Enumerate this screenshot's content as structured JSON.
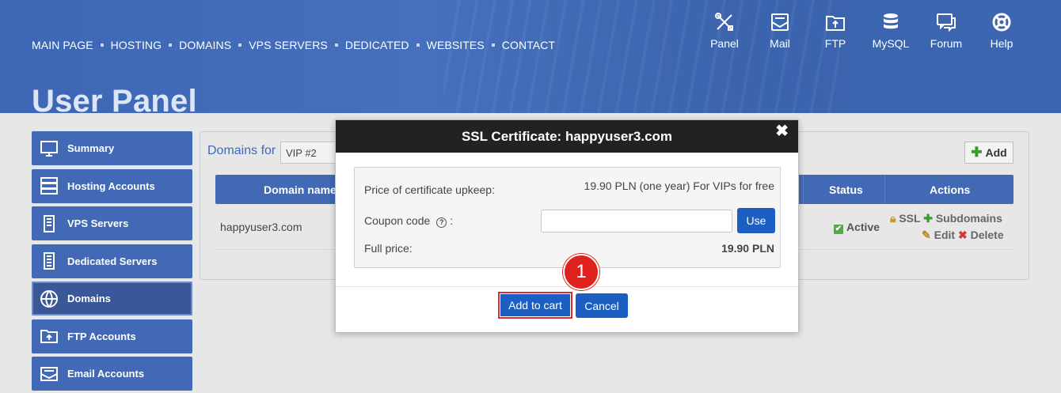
{
  "nav": {
    "items": [
      "MAIN PAGE",
      "HOSTING",
      "DOMAINS",
      "VPS SERVERS",
      "DEDICATED",
      "WEBSITES",
      "CONTACT"
    ]
  },
  "tools": [
    {
      "label": "Panel",
      "icon": "tools-icon"
    },
    {
      "label": "Mail",
      "icon": "mail-icon"
    },
    {
      "label": "FTP",
      "icon": "folder-upload-icon"
    },
    {
      "label": "MySQL",
      "icon": "database-icon"
    },
    {
      "label": "Forum",
      "icon": "chat-icon"
    },
    {
      "label": "Help",
      "icon": "lifebuoy-icon"
    }
  ],
  "page_title": "User Panel",
  "sidebar": {
    "items": [
      {
        "label": "Summary",
        "icon": "monitor-icon"
      },
      {
        "label": "Hosting Accounts",
        "icon": "server-icon"
      },
      {
        "label": "VPS Servers",
        "icon": "vps-icon"
      },
      {
        "label": "Dedicated Servers",
        "icon": "dedicated-icon"
      },
      {
        "label": "Domains",
        "icon": "www-globe-icon"
      },
      {
        "label": "FTP Accounts",
        "icon": "ftp-folder-icon"
      },
      {
        "label": "Email Accounts",
        "icon": "email-icon"
      }
    ],
    "active": "Domains"
  },
  "domains": {
    "label": "Domains for",
    "selected": "VIP #2",
    "add_label": "Add",
    "columns": [
      "Domain name",
      "Status",
      "Actions"
    ],
    "row": {
      "domain": "happyuser3.com",
      "status": "Active",
      "actions": [
        "SSL",
        "Subdomains",
        "Edit",
        "Delete"
      ]
    }
  },
  "modal": {
    "title": "SSL Certificate: happyuser3.com",
    "close": "✖",
    "price_label": "Price of certificate upkeep:",
    "price_value": "19.90 PLN (one year) For VIPs for free",
    "coupon_label": "Coupon code",
    "coupon_colon": ":",
    "coupon_value": "",
    "use_label": "Use",
    "full_price_label": "Full price:",
    "full_price_value": "19.90 PLN",
    "add_to_cart": "Add to cart",
    "cancel": "Cancel"
  },
  "annotation": {
    "step": "1"
  },
  "colors": {
    "brand": "#4169b6",
    "button": "#1a5fc1",
    "highlight": "#d62c2c"
  }
}
